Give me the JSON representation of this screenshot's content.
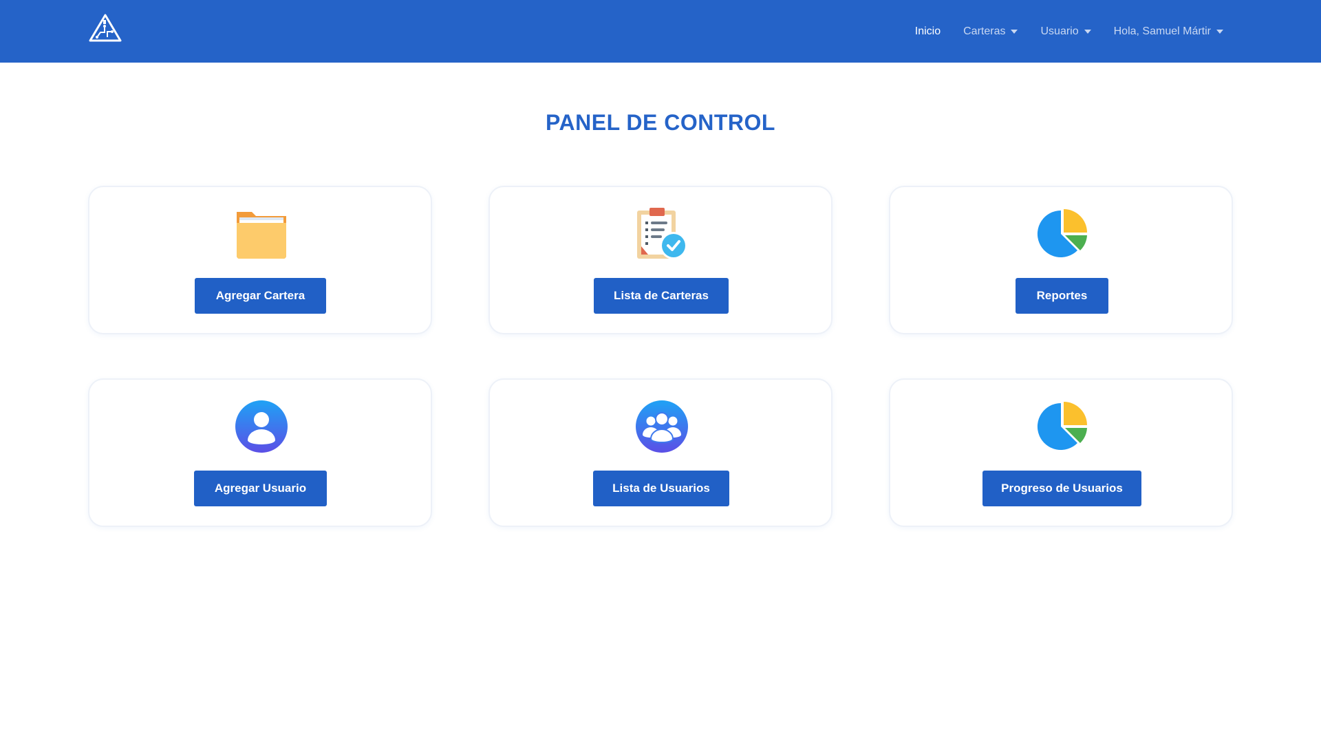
{
  "navbar": {
    "logo_icon": "mountain-circuit-logo-icon",
    "items": [
      {
        "label": "Inicio",
        "active": true
      },
      {
        "label": "Carteras",
        "dropdown": true
      },
      {
        "label": "Usuario",
        "dropdown": true
      },
      {
        "label": "Hola, Samuel Mártir",
        "dropdown": true
      }
    ]
  },
  "main": {
    "title": "PANEL DE CONTROL",
    "cards": [
      {
        "button": "Agregar Cartera",
        "icon": "folder-icon"
      },
      {
        "button": "Lista de Carteras",
        "icon": "clipboard-check-icon"
      },
      {
        "button": "Reportes",
        "icon": "pie-chart-icon"
      },
      {
        "button": "Agregar Usuario",
        "icon": "user-icon"
      },
      {
        "button": "Lista de Usuarios",
        "icon": "users-group-icon"
      },
      {
        "button": "Progreso de Usuarios",
        "icon": "pie-chart-icon"
      }
    ]
  },
  "colors": {
    "primary": "#2563C8",
    "button": "#2160C6",
    "nav_text": "#C9D8F2"
  }
}
